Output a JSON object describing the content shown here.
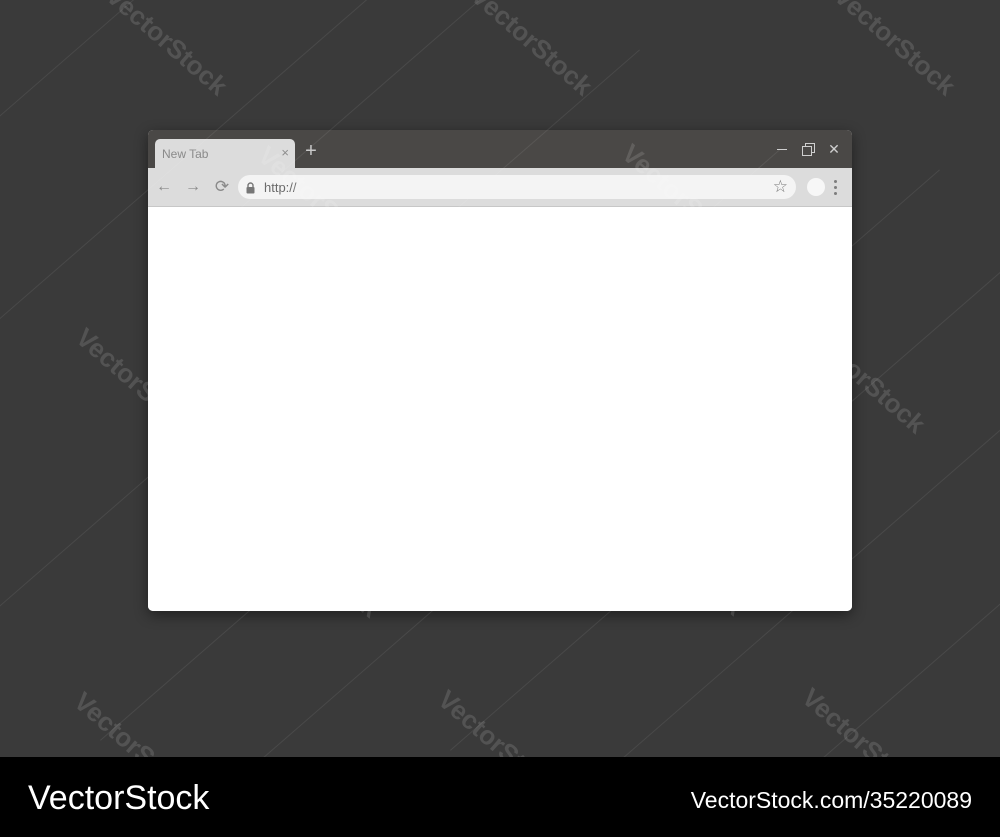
{
  "browser": {
    "tab": {
      "title": "New Tab",
      "close_glyph": "×"
    },
    "new_tab_glyph": "+",
    "window_controls": {
      "close_glyph": "✕"
    },
    "toolbar": {
      "back_glyph": "←",
      "forward_glyph": "→",
      "reload_glyph": "⟳",
      "url": "http://",
      "bookmark_glyph": "☆"
    }
  },
  "watermark": {
    "text": "VectorStock"
  },
  "footer": {
    "brand": "VectorStock",
    "image_ref": "VectorStock.com/35220089"
  },
  "colors": {
    "background": "#3a3a3a",
    "titlebar": "#4a4846",
    "toolbar": "#dcdcdc",
    "omnibox": "#f4f4f4",
    "content": "#ffffff",
    "footer": "#000000"
  },
  "icons": [
    "back-arrow-icon",
    "forward-arrow-icon",
    "reload-icon",
    "lock-icon",
    "star-icon",
    "kebab-menu-icon",
    "minimize-icon",
    "restore-icon",
    "close-icon",
    "plus-icon"
  ]
}
